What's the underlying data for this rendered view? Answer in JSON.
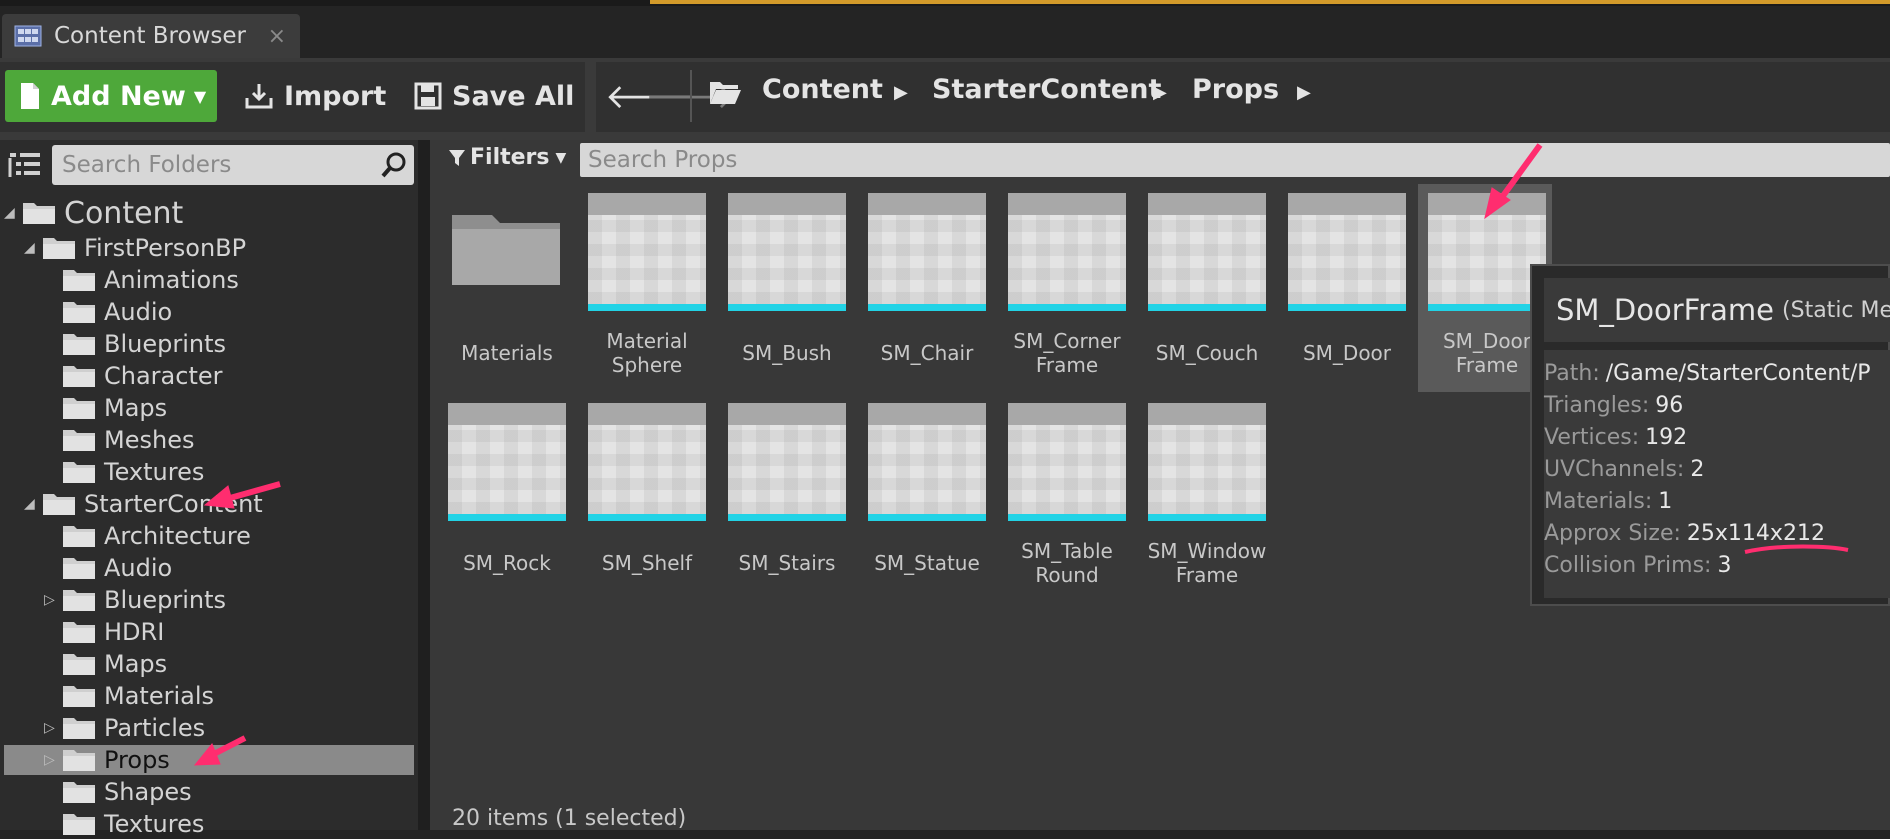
{
  "tab": {
    "title": "Content Browser",
    "close": "×"
  },
  "toolbar": {
    "add_new": "Add New",
    "import": "Import",
    "save_all": "Save All"
  },
  "path": {
    "crumbs": [
      "Content",
      "StarterContent",
      "Props"
    ]
  },
  "sidebar": {
    "search_placeholder": "Search Folders",
    "tree": [
      {
        "label": "Content",
        "level": 0,
        "expanded": true
      },
      {
        "label": "FirstPersonBP",
        "level": 1,
        "expanded": true
      },
      {
        "label": "Animations",
        "level": 2
      },
      {
        "label": "Audio",
        "level": 2
      },
      {
        "label": "Blueprints",
        "level": 2
      },
      {
        "label": "Character",
        "level": 2
      },
      {
        "label": "Maps",
        "level": 2
      },
      {
        "label": "Meshes",
        "level": 2
      },
      {
        "label": "Textures",
        "level": 2
      },
      {
        "label": "StarterContent",
        "level": 1,
        "expanded": true
      },
      {
        "label": "Architecture",
        "level": 2
      },
      {
        "label": "Audio",
        "level": 2
      },
      {
        "label": "Blueprints",
        "level": 2,
        "collapsed": true
      },
      {
        "label": "HDRI",
        "level": 2
      },
      {
        "label": "Maps",
        "level": 2
      },
      {
        "label": "Materials",
        "level": 2
      },
      {
        "label": "Particles",
        "level": 2,
        "collapsed": true
      },
      {
        "label": "Props",
        "level": 2,
        "collapsed": true,
        "selected": true
      },
      {
        "label": "Shapes",
        "level": 2
      },
      {
        "label": "Textures",
        "level": 2
      }
    ]
  },
  "assets": {
    "filters_label": "Filters",
    "search_placeholder": "Search Props",
    "row1": [
      {
        "line1": "Materials",
        "line2": ""
      },
      {
        "line1": "Material",
        "line2": "Sphere"
      },
      {
        "line1": "SM_Bush",
        "line2": ""
      },
      {
        "line1": "SM_Chair",
        "line2": ""
      },
      {
        "line1": "SM_Corner",
        "line2": "Frame"
      },
      {
        "line1": "SM_Couch",
        "line2": ""
      },
      {
        "line1": "SM_Door",
        "line2": ""
      },
      {
        "line1": "SM_Door",
        "line2": "Frame"
      }
    ],
    "row2": [
      {
        "line1": "SM_Rock",
        "line2": ""
      },
      {
        "line1": "SM_Shelf",
        "line2": ""
      },
      {
        "line1": "SM_Stairs",
        "line2": ""
      },
      {
        "line1": "SM_Statue",
        "line2": ""
      },
      {
        "line1": "SM_Table",
        "line2": "Round"
      },
      {
        "line1": "SM_Window",
        "line2": "Frame"
      }
    ],
    "status": "20 items (1 selected)"
  },
  "tooltip": {
    "name": "SM_DoorFrame",
    "type": "(Static Me",
    "rows": [
      {
        "k": "Path:",
        "v": "/Game/StarterContent/P"
      },
      {
        "k": "Triangles:",
        "v": "96"
      },
      {
        "k": "Vertices:",
        "v": "192"
      },
      {
        "k": "UVChannels:",
        "v": "2"
      },
      {
        "k": "Materials:",
        "v": "1"
      },
      {
        "k": "Approx Size:",
        "v": "25x114x212"
      },
      {
        "k": "Collision Prims:",
        "v": "3"
      }
    ]
  },
  "colors": {
    "accent_green": "#4ea83a",
    "thumb_underline": "#22d3e6",
    "annotation": "#ff2d6f"
  }
}
